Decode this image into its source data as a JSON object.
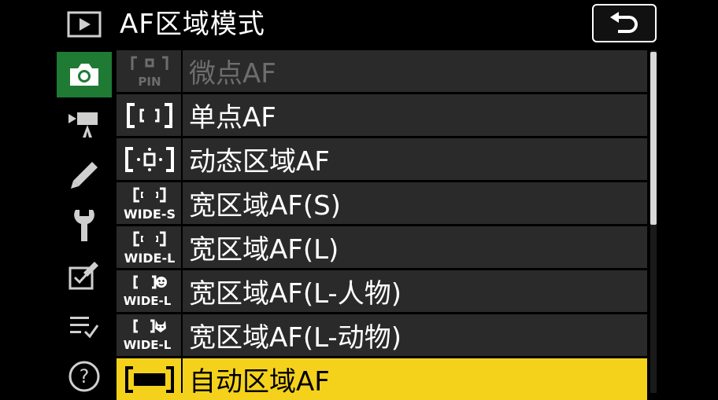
{
  "header": {
    "title": "AF区域模式"
  },
  "sidebar": {
    "items": [
      {
        "icon": "playback-icon"
      },
      {
        "icon": "camera-icon",
        "active": true
      },
      {
        "icon": "movie-camera-icon"
      },
      {
        "icon": "pencil-icon"
      },
      {
        "icon": "wrench-icon"
      },
      {
        "icon": "retouch-icon"
      },
      {
        "icon": "my-menu-icon"
      },
      {
        "icon": "help-icon",
        "text": "?"
      }
    ]
  },
  "menu": {
    "items": [
      {
        "label": "微点AF",
        "icon": "pin-point-af-icon",
        "icon_text": "PIN",
        "disabled": true
      },
      {
        "label": "单点AF",
        "icon": "single-point-af-icon"
      },
      {
        "label": "动态区域AF",
        "icon": "dynamic-area-af-icon"
      },
      {
        "label": "宽区域AF(S)",
        "icon": "wide-area-s-icon",
        "icon_text": "WIDE-S"
      },
      {
        "label": "宽区域AF(L)",
        "icon": "wide-area-l-icon",
        "icon_text": "WIDE-L"
      },
      {
        "label": "宽区域AF(L-人物)",
        "icon": "wide-area-l-people-icon",
        "icon_text": "WIDE-L"
      },
      {
        "label": "宽区域AF(L-动物)",
        "icon": "wide-area-l-animal-icon",
        "icon_text": "WIDE-L"
      },
      {
        "label": "自动区域AF",
        "icon": "auto-area-af-icon",
        "selected": true
      }
    ]
  },
  "colors": {
    "active_tab": "#1f7a34",
    "selected_row": "#f4d21c",
    "row_bg": "#2a2a2a",
    "disabled_text": "#6d6d6d"
  }
}
